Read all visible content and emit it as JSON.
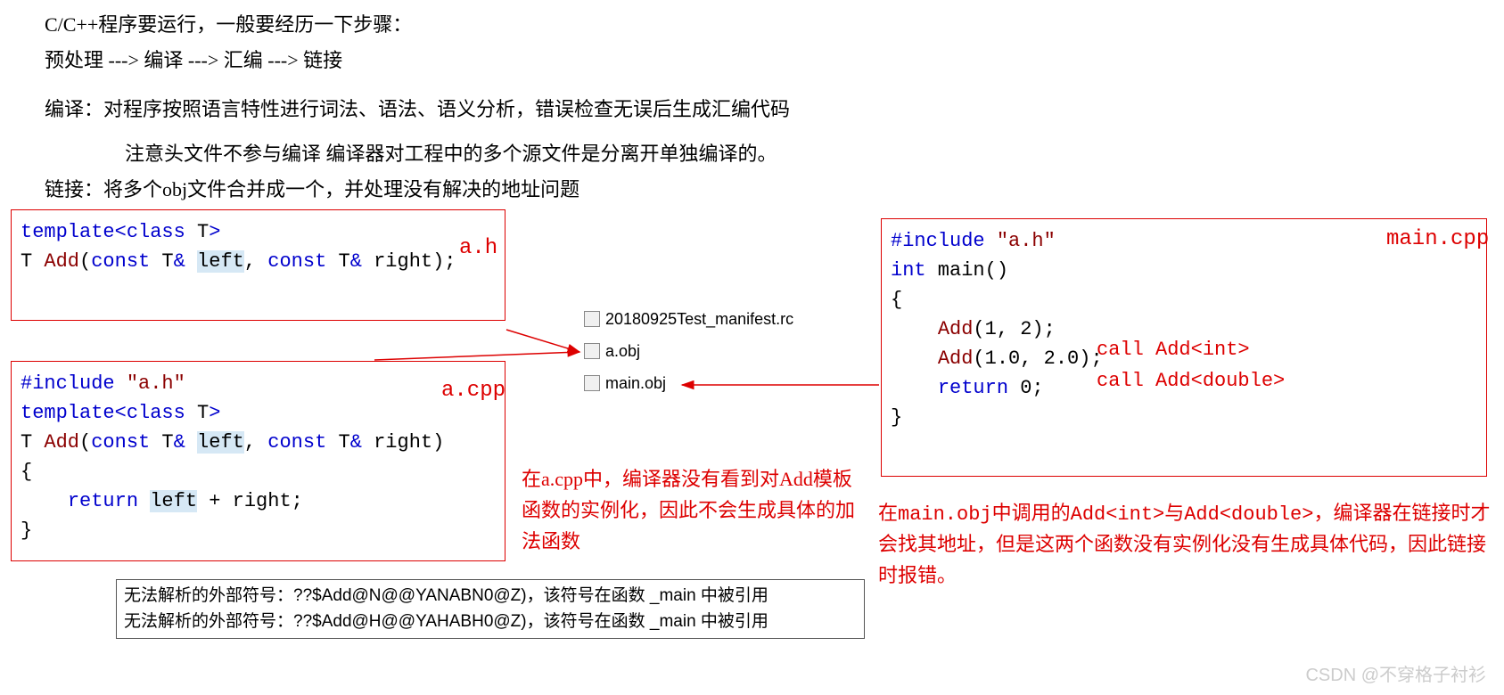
{
  "intro": {
    "line1": "C/C++程序要运行，一般要经历一下步骤：",
    "line2": "预处理 ---> 编译 ---> 汇编 ---> 链接",
    "line3": "编译：对程序按照语言特性进行词法、语法、语义分析，错误检查无误后生成汇编代码",
    "line4": "注意头文件不参与编译  编译器对工程中的多个源文件是分离开单独编译的。",
    "line5": "链接：将多个obj文件合并成一个，并处理没有解决的地址问题"
  },
  "ah": {
    "label": "a.h",
    "l1a": "template",
    "l1b": "<",
    "l1c": "class",
    "l1d": " T",
    "l1e": ">",
    "l2a": "T ",
    "l2b": "Add",
    "l2c": "(",
    "l2d": "const",
    "l2e": " T",
    "l2f": "& ",
    "l2g": "left",
    "l2h": ", ",
    "l2i": "const",
    "l2j": " T",
    "l2k": "& ",
    "l2l": "right",
    "l2m": ");"
  },
  "acpp": {
    "label": "a.cpp",
    "l1a": "#include ",
    "l1b": "\"a.h\"",
    "l2a": "template",
    "l2b": "<",
    "l2c": "class",
    "l2d": " T",
    "l2e": ">",
    "l3a": "T ",
    "l3b": "Add",
    "l3c": "(",
    "l3d": "const",
    "l3e": " T",
    "l3f": "& ",
    "l3g": "left",
    "l3h": ", ",
    "l3i": "const",
    "l3j": " T",
    "l3k": "& ",
    "l3l": "right",
    "l3m": ")",
    "l4": "{",
    "l5a": "    ",
    "l5b": "return",
    "l5c": " ",
    "l5d": "left",
    "l5e": " + ",
    "l5f": "right",
    "l5g": ";",
    "l6": "}"
  },
  "maincpp": {
    "label": "main.cpp",
    "l1a": "#include ",
    "l1b": "\"a.h\"",
    "l2a": "int",
    "l2b": " main",
    "l2c": "()",
    "l3": "{",
    "l4a": "    ",
    "l4b": "Add",
    "l4c": "(1, 2);",
    "l5a": "    ",
    "l5b": "Add",
    "l5c": "(1.0, 2.0);",
    "l6a": "    ",
    "l6b": "return",
    "l6c": " 0;",
    "l7": "}",
    "call1": "call Add<int>",
    "call2": "call Add<double>"
  },
  "files": {
    "f1": "20180925Test_manifest.rc",
    "f2": "a.obj",
    "f3": "main.obj"
  },
  "annot": {
    "acpp_note": "在a.cpp中，编译器没有看到对Add模板函数的实例化，因此不会生成具体的加法函数",
    "main_note": "在main.obj中调用的Add<int>与Add<double>，编译器在链接时才会找其地址，但是这两个函数没有实例化没有生成具体代码，因此链接时报错。"
  },
  "errors": {
    "e1": "无法解析的外部符号：??$Add@N@@YANABN0@Z)，该符号在函数 _main 中被引用",
    "e2": "无法解析的外部符号：??$Add@H@@YAHABH0@Z)，该符号在函数 _main 中被引用"
  },
  "watermark": "CSDN @不穿格子衬衫"
}
